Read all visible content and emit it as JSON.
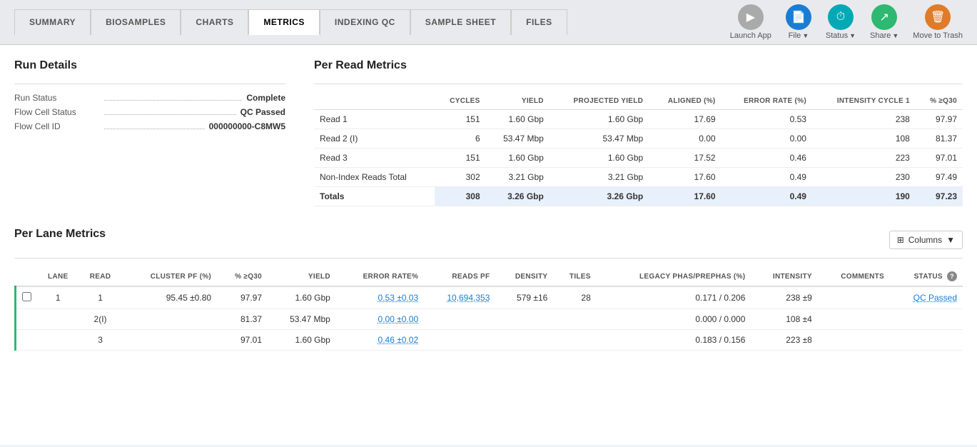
{
  "tabs": [
    {
      "label": "SUMMARY",
      "active": false
    },
    {
      "label": "BIOSAMPLES",
      "active": false
    },
    {
      "label": "CHARTS",
      "active": false
    },
    {
      "label": "METRICS",
      "active": true
    },
    {
      "label": "INDEXING QC",
      "active": false
    },
    {
      "label": "SAMPLE SHEET",
      "active": false
    },
    {
      "label": "FILES",
      "active": false
    }
  ],
  "actions": {
    "launch_app": "Launch App",
    "file": "File",
    "status": "Status",
    "share": "Share",
    "move_to_trash": "Move to Trash"
  },
  "run_details": {
    "title": "Run Details",
    "fields": [
      {
        "label": "Run Status",
        "value": "Complete"
      },
      {
        "label": "Flow Cell Status",
        "value": "QC Passed"
      },
      {
        "label": "Flow Cell ID",
        "value": "000000000-C8MW5"
      }
    ]
  },
  "per_read_metrics": {
    "title": "Per Read Metrics",
    "columns": [
      "",
      "CYCLES",
      "YIELD",
      "PROJECTED YIELD",
      "ALIGNED (%)",
      "ERROR RATE (%)",
      "INTENSITY CYCLE 1",
      "% ≥Q30"
    ],
    "rows": [
      {
        "name": "Read 1",
        "cycles": "151",
        "yield": "1.60 Gbp",
        "projected_yield": "1.60 Gbp",
        "aligned": "17.69",
        "error_rate": "0.53",
        "intensity": "238",
        "q30": "97.97"
      },
      {
        "name": "Read 2 (I)",
        "cycles": "6",
        "yield": "53.47 Mbp",
        "projected_yield": "53.47 Mbp",
        "aligned": "0.00",
        "error_rate": "0.00",
        "intensity": "108",
        "q30": "81.37"
      },
      {
        "name": "Read 3",
        "cycles": "151",
        "yield": "1.60 Gbp",
        "projected_yield": "1.60 Gbp",
        "aligned": "17.52",
        "error_rate": "0.46",
        "intensity": "223",
        "q30": "97.01"
      },
      {
        "name": "Non-Index Reads Total",
        "cycles": "302",
        "yield": "3.21 Gbp",
        "projected_yield": "3.21 Gbp",
        "aligned": "17.60",
        "error_rate": "0.49",
        "intensity": "230",
        "q30": "97.49"
      }
    ],
    "totals": {
      "name": "Totals",
      "cycles": "308",
      "yield": "3.26 Gbp",
      "projected_yield": "3.26 Gbp",
      "aligned": "17.60",
      "error_rate": "0.49",
      "intensity": "190",
      "q30": "97.23"
    }
  },
  "per_lane_metrics": {
    "title": "Per Lane Metrics",
    "columns_button": "Columns",
    "columns": [
      "",
      "LANE",
      "READ",
      "CLUSTER PF (%)",
      "% ≥Q30",
      "YIELD",
      "ERROR RATE%",
      "READS PF",
      "DENSITY",
      "TILES",
      "LEGACY PHAS/PREPHAS (%)",
      "INTENSITY",
      "COMMENTS",
      "STATUS"
    ],
    "rows": [
      {
        "lane": "1",
        "read": "1",
        "cluster_pf": "95.45 ±0.80",
        "q30": "97.97",
        "yield": "1.60 Gbp",
        "error_rate": "0.53 ±0.03",
        "reads_pf": "10,694,353",
        "density": "579 ±16",
        "tiles": "28",
        "legacy_phas": "0.171 / 0.206",
        "intensity": "238 ±9",
        "comments": "",
        "status": "QC Passed",
        "is_first_in_group": true
      },
      {
        "lane": "",
        "read": "2(I)",
        "cluster_pf": "",
        "q30": "81.37",
        "yield": "53.47 Mbp",
        "error_rate": "0.00 ±0.00",
        "reads_pf": "",
        "density": "",
        "tiles": "",
        "legacy_phas": "0.000 / 0.000",
        "intensity": "108 ±4",
        "comments": "",
        "status": "",
        "is_first_in_group": false
      },
      {
        "lane": "",
        "read": "3",
        "cluster_pf": "",
        "q30": "97.01",
        "yield": "1.60 Gbp",
        "error_rate": "0.46 ±0.02",
        "reads_pf": "",
        "density": "",
        "tiles": "",
        "legacy_phas": "0.183 / 0.156",
        "intensity": "223 ±8",
        "comments": "",
        "status": "",
        "is_first_in_group": false
      }
    ]
  }
}
